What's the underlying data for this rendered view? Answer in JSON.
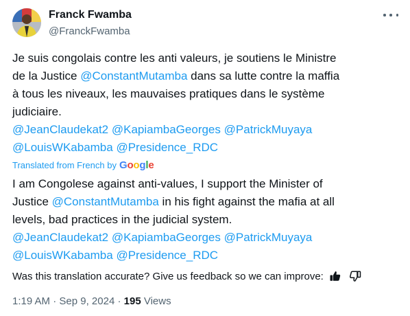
{
  "author": {
    "name": "Franck Fwamba",
    "handle": "@FranckFwamba"
  },
  "original": {
    "line1": "Je suis congolais contre les anti valeurs, je soutiens le Ministre",
    "line2_prefix": "de la Justice ",
    "line2_mention": "@ConstantMutamba",
    "line2_suffix": " dans sa lutte contre la maffia",
    "line3": "à tous les niveaux, les mauvaises pratiques dans le système",
    "line4": "judiciaire.",
    "mentions1": [
      "@JeanClaudekat2",
      "@KapiambaGeorges",
      "@PatrickMuyaya"
    ],
    "mentions2": [
      "@LouisWKabamba",
      "@Presidence_RDC"
    ]
  },
  "translation_label": {
    "text": "Translated from French by",
    "provider": "Google"
  },
  "translated": {
    "line1": "I am Congolese against anti-values, I support the Minister of",
    "line2_prefix": "Justice ",
    "line2_mention": "@ConstantMutamba",
    "line2_suffix": " in his fight against the mafia at all",
    "line3": "levels, bad practices in the judicial system.",
    "mentions1": [
      "@JeanClaudekat2",
      "@KapiambaGeorges",
      "@PatrickMuyaya"
    ],
    "mentions2": [
      "@LouisWKabamba",
      "@Presidence_RDC"
    ]
  },
  "feedback": {
    "question": "Was this translation accurate? Give us feedback so we can improve:"
  },
  "meta": {
    "time": "1:19 AM",
    "separator": "·",
    "date": "Sep 9, 2024",
    "views_count": "195",
    "views_label": "Views"
  },
  "icons": [
    "more-icon",
    "thumbs-up-icon",
    "thumbs-down-icon"
  ],
  "colors": {
    "link": "#1d9bf0",
    "secondary_text": "#536471",
    "primary_text": "#0f1419"
  }
}
